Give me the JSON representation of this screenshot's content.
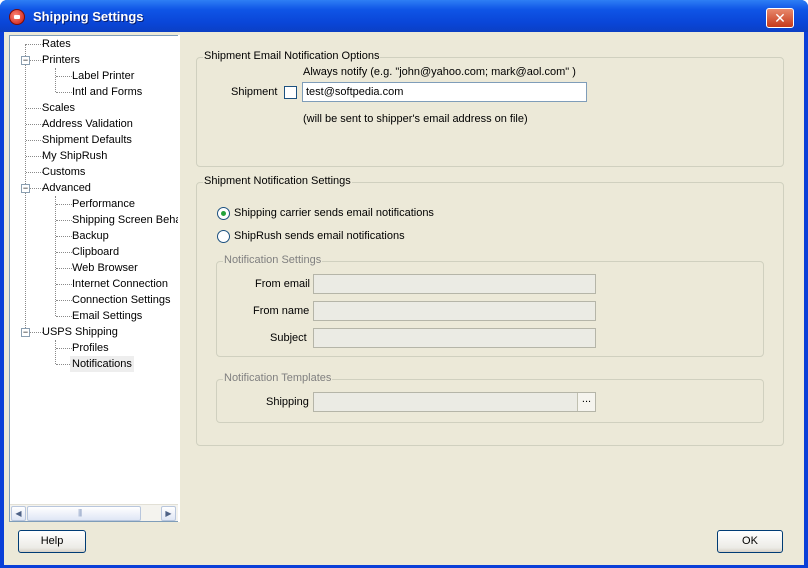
{
  "window": {
    "title": "Shipping Settings",
    "close_symbol": "✕"
  },
  "tree": {
    "items": [
      {
        "label": "Rates"
      },
      {
        "label": "Printers",
        "expander": "−"
      },
      {
        "label": "Label Printer"
      },
      {
        "label": "Intl and Forms"
      },
      {
        "label": "Scales"
      },
      {
        "label": "Address Validation"
      },
      {
        "label": "Shipment Defaults"
      },
      {
        "label": "My ShipRush"
      },
      {
        "label": "Customs"
      },
      {
        "label": "Advanced",
        "expander": "−"
      },
      {
        "label": "Performance"
      },
      {
        "label": "Shipping Screen Behavior"
      },
      {
        "label": "Backup"
      },
      {
        "label": "Clipboard"
      },
      {
        "label": "Web Browser"
      },
      {
        "label": "Internet Connection"
      },
      {
        "label": "Connection Settings"
      },
      {
        "label": "Email Settings"
      },
      {
        "label": "USPS Shipping",
        "expander": "−"
      },
      {
        "label": "Profiles"
      },
      {
        "label": "Notifications",
        "selected": true
      }
    ],
    "scroll_left": "◀",
    "scroll_right": "▶"
  },
  "email_options": {
    "legend": "Shipment Email Notification Options",
    "always_notify_label": "Always notify (e.g. \"john@yahoo.com; mark@aol.com\" )",
    "shipment_label": "Shipment",
    "shipment_checked": false,
    "email_value": "test@softpedia.com",
    "note": "(will be sent to shipper's email address on file)"
  },
  "notification_settings": {
    "legend": "Shipment Notification Settings",
    "radio_carrier": "Shipping carrier sends email notifications",
    "radio_shiprush": "ShipRush sends email notifications",
    "selected": "carrier",
    "sub_legend": "Notification Settings",
    "from_email_label": "From email",
    "from_email_value": "",
    "from_name_label": "From name",
    "from_name_value": "",
    "subject_label": "Subject",
    "subject_value": "",
    "templates_legend": "Notification Templates",
    "shipping_label": "Shipping",
    "shipping_value": "",
    "browse_label": "..."
  },
  "buttons": {
    "help": "Help",
    "ok": "OK"
  }
}
